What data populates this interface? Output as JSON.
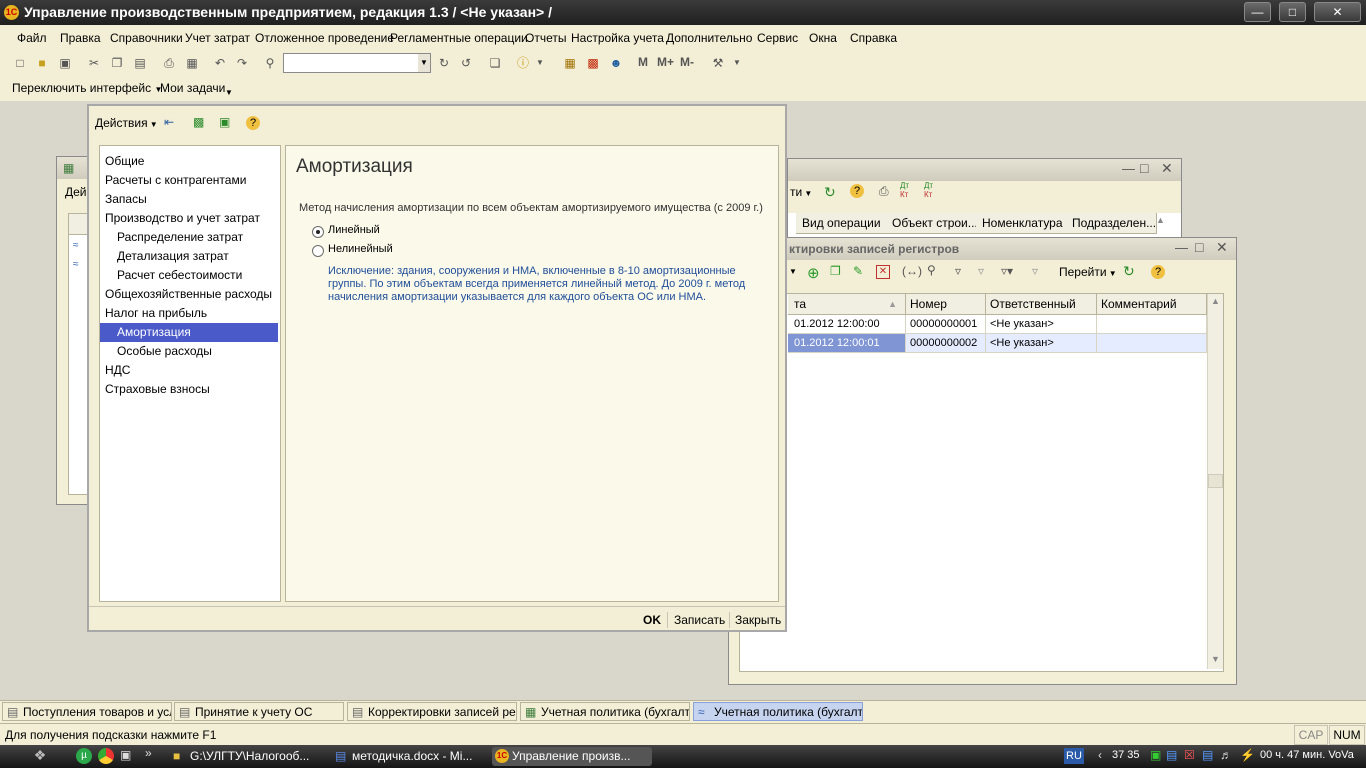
{
  "app": {
    "title": "Управление производственным предприятием, редакция 1.3 / <Не указан> /",
    "logo_text": "1С"
  },
  "menu": [
    "Файл",
    "Правка",
    "Справочники",
    "Учет затрат",
    "Отложенное проведение",
    "Регламентные операции",
    "Отчеты",
    "Настройка учета",
    "Дополнительно",
    "Сервис",
    "Окна",
    "Справка"
  ],
  "toolbar": {
    "search_value": "",
    "m_label": "М",
    "mplus_label": "М+",
    "mminus_label": "М-"
  },
  "panel": {
    "switch_interface": "Переключить интерфейс",
    "my_tasks": "Мои задачи"
  },
  "bg_window_left": {
    "toolbar_label": "Дей"
  },
  "bg_window_docs": {
    "goto_label": "ти",
    "headers": [
      "Вид операции",
      "Объект строи...",
      "Номенклатура",
      "Подразделен..."
    ]
  },
  "corrections_window": {
    "title": "ктировки записей регистров",
    "goto_label": "Перейти",
    "headers": [
      "та",
      "Номер",
      "Ответственный",
      "Комментарий"
    ],
    "rows": [
      {
        "date": "01.2012 12:00:00",
        "number": "00000000001",
        "responsible": "<Не указан>",
        "comment": ""
      },
      {
        "date": "01.2012 12:00:01",
        "number": "00000000002",
        "responsible": "<Не указан>",
        "comment": ""
      }
    ]
  },
  "policy_window": {
    "actions_label": "Действия",
    "nav_items": [
      {
        "label": "Общие",
        "indent": false,
        "selected": false
      },
      {
        "label": "Расчеты с контрагентами",
        "indent": false,
        "selected": false
      },
      {
        "label": "Запасы",
        "indent": false,
        "selected": false
      },
      {
        "label": "Производство и учет затрат",
        "indent": false,
        "selected": false
      },
      {
        "label": "Распределение затрат",
        "indent": true,
        "selected": false
      },
      {
        "label": "Детализация затрат",
        "indent": true,
        "selected": false
      },
      {
        "label": "Расчет себестоимости",
        "indent": true,
        "selected": false
      },
      {
        "label": "Общехозяйственные расходы",
        "indent": false,
        "selected": false
      },
      {
        "label": "Налог на прибыль",
        "indent": false,
        "selected": false
      },
      {
        "label": "Амортизация",
        "indent": true,
        "selected": true
      },
      {
        "label": "Особые расходы",
        "indent": true,
        "selected": false
      },
      {
        "label": "НДС",
        "indent": false,
        "selected": false
      },
      {
        "label": "Страховые взносы",
        "indent": false,
        "selected": false
      }
    ],
    "section_title": "Амортизация",
    "method_label": "Метод начисления амортизации по всем объектам амортизируемого имущества (с 2009 г.)",
    "radio_linear": "Линейный",
    "radio_nonlinear": "Нелинейный",
    "selected_method": "linear",
    "note_line1": "Исключение: здания, сооружения и НМА, включенные в 8-10 амортизационные",
    "note_line2": "группы. По этим объектам всегда применяется линейный метод. До 2009 г. метод",
    "note_line3": "начисления амортизации указывается для каждого объекта ОС или НМА.",
    "ok_label": "OK",
    "save_label": "Записать",
    "close_label": "Закрыть",
    "accent": "#4a5ac8"
  },
  "tabs_1c": [
    "Поступления товаров и услуг",
    "Принятие к учету ОС",
    "Корректировки записей ре...",
    "Учетная политика (бухгалт...",
    "Учетная политика (бухгалт..."
  ],
  "status": {
    "hint": "Для получения подсказки нажмите F1",
    "cap": "CAP",
    "num": "NUM"
  },
  "win_taskbar": {
    "items": [
      "G:\\УЛГТУ\\Налогооб...",
      "методичка.docx - Mi...",
      "Управление произв..."
    ],
    "lang": "RU",
    "tray_text": "37 35",
    "clock": "00 ч. 47 мин. VoVa"
  }
}
